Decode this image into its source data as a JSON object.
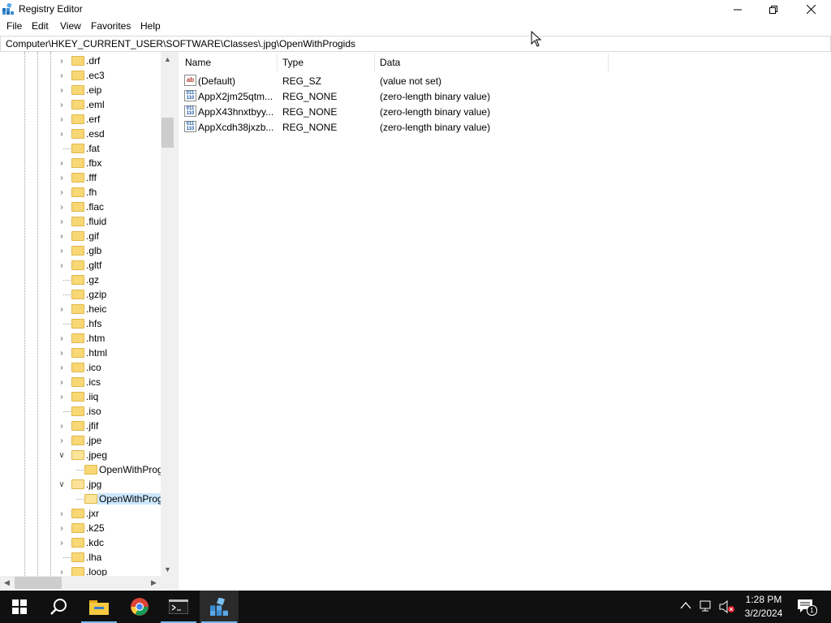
{
  "window": {
    "title": "Registry Editor"
  },
  "menu": [
    "File",
    "Edit",
    "View",
    "Favorites",
    "Help"
  ],
  "address": "Computer\\HKEY_CURRENT_USER\\SOFTWARE\\Classes\\.jpg\\OpenWithProgids",
  "tree": [
    {
      "label": ".drf",
      "exp": "collapsed"
    },
    {
      "label": ".ec3",
      "exp": "collapsed"
    },
    {
      "label": ".eip",
      "exp": "collapsed"
    },
    {
      "label": ".eml",
      "exp": "collapsed"
    },
    {
      "label": ".erf",
      "exp": "collapsed"
    },
    {
      "label": ".esd",
      "exp": "collapsed"
    },
    {
      "label": ".fat",
      "exp": "none"
    },
    {
      "label": ".fbx",
      "exp": "collapsed"
    },
    {
      "label": ".fff",
      "exp": "collapsed"
    },
    {
      "label": ".fh",
      "exp": "collapsed"
    },
    {
      "label": ".flac",
      "exp": "collapsed"
    },
    {
      "label": ".fluid",
      "exp": "collapsed"
    },
    {
      "label": ".gif",
      "exp": "collapsed"
    },
    {
      "label": ".glb",
      "exp": "collapsed"
    },
    {
      "label": ".gltf",
      "exp": "collapsed"
    },
    {
      "label": ".gz",
      "exp": "none"
    },
    {
      "label": ".gzip",
      "exp": "none"
    },
    {
      "label": ".heic",
      "exp": "collapsed"
    },
    {
      "label": ".hfs",
      "exp": "none"
    },
    {
      "label": ".htm",
      "exp": "collapsed"
    },
    {
      "label": ".html",
      "exp": "collapsed"
    },
    {
      "label": ".ico",
      "exp": "collapsed"
    },
    {
      "label": ".ics",
      "exp": "collapsed"
    },
    {
      "label": ".iiq",
      "exp": "collapsed"
    },
    {
      "label": ".iso",
      "exp": "none"
    },
    {
      "label": ".jfif",
      "exp": "collapsed"
    },
    {
      "label": ".jpe",
      "exp": "collapsed"
    },
    {
      "label": ".jpeg",
      "exp": "expanded"
    },
    {
      "label": "OpenWithProgids",
      "exp": "child"
    },
    {
      "label": ".jpg",
      "exp": "expanded"
    },
    {
      "label": "OpenWithProgids",
      "exp": "child",
      "selected": true
    },
    {
      "label": ".jxr",
      "exp": "collapsed"
    },
    {
      "label": ".k25",
      "exp": "collapsed"
    },
    {
      "label": ".kdc",
      "exp": "collapsed"
    },
    {
      "label": ".lha",
      "exp": "none"
    },
    {
      "label": ".loop",
      "exp": "collapsed"
    }
  ],
  "columns": {
    "name": "Name",
    "type": "Type",
    "data": "Data"
  },
  "values": [
    {
      "icon": "string-value-icon",
      "name": "(Default)",
      "type": "REG_SZ",
      "data": "(value not set)"
    },
    {
      "icon": "binary-value-icon",
      "name": "AppX2jm25qtm...",
      "type": "REG_NONE",
      "data": "(zero-length binary value)"
    },
    {
      "icon": "binary-value-icon",
      "name": "AppX43hnxtbyy...",
      "type": "REG_NONE",
      "data": "(zero-length binary value)"
    },
    {
      "icon": "binary-value-icon",
      "name": "AppXcdh38jxzb...",
      "type": "REG_NONE",
      "data": "(zero-length binary value)"
    }
  ],
  "taskbar": {
    "items": [
      "start-icon",
      "search-icon",
      "file-explorer-icon",
      "chrome-icon",
      "terminal-icon",
      "registry-editor-icon"
    ],
    "time": "1:28 PM",
    "date": "3/2/2024",
    "notification_count": "1"
  },
  "colors": {
    "selection": "#cce8ff",
    "taskbar": "#101010",
    "folder": "#f8d775"
  }
}
